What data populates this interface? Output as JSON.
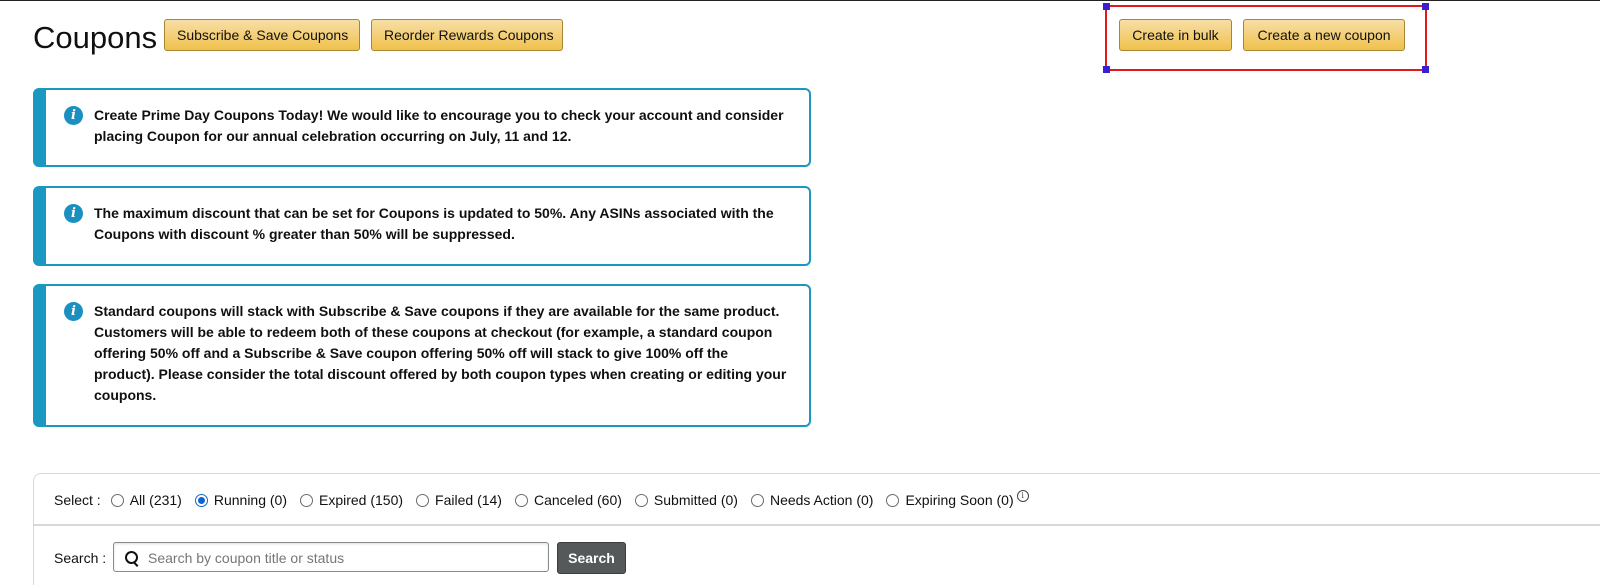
{
  "header": {
    "title": "Coupons",
    "subscribe_save_label": "Subscribe & Save Coupons",
    "reorder_rewards_label": "Reorder Rewards Coupons",
    "create_bulk_label": "Create in bulk",
    "create_new_label": "Create a new coupon"
  },
  "alerts": [
    {
      "text": "Create Prime Day Coupons Today! We would like to encourage you to check your account and consider placing Coupon for our annual celebration occurring on July, 11 and 12."
    },
    {
      "text": "The maximum discount that can be set for Coupons is updated to 50%. Any ASINs associated with the Coupons with discount % greater than 50% will be suppressed."
    },
    {
      "text": "Standard coupons will stack with Subscribe & Save coupons if they are available for the same product. Customers will be able to redeem both of these coupons at checkout (for example, a standard coupon offering 50% off and a Subscribe & Save coupon offering 50% off will stack to give 100% off the product). Please consider the total discount offered by both coupon types when creating or editing your coupons."
    }
  ],
  "filters": {
    "label": "Select :",
    "selected": "Running (0)",
    "options": [
      {
        "label": "All (231)"
      },
      {
        "label": "Running (0)"
      },
      {
        "label": "Expired (150)"
      },
      {
        "label": "Failed (14)"
      },
      {
        "label": "Canceled (60)"
      },
      {
        "label": "Submitted (0)"
      },
      {
        "label": "Needs Action (0)"
      },
      {
        "label": "Expiring Soon (0)"
      }
    ]
  },
  "search": {
    "label": "Search :",
    "placeholder": "Search by coupon title or status",
    "button_label": "Search"
  },
  "colors": {
    "button_yellow": "#f0c14b",
    "alert_blue": "#1a98c2",
    "highlight_red": "#e01a1a",
    "radio_selected": "#0b66d1",
    "search_button": "#565959"
  }
}
